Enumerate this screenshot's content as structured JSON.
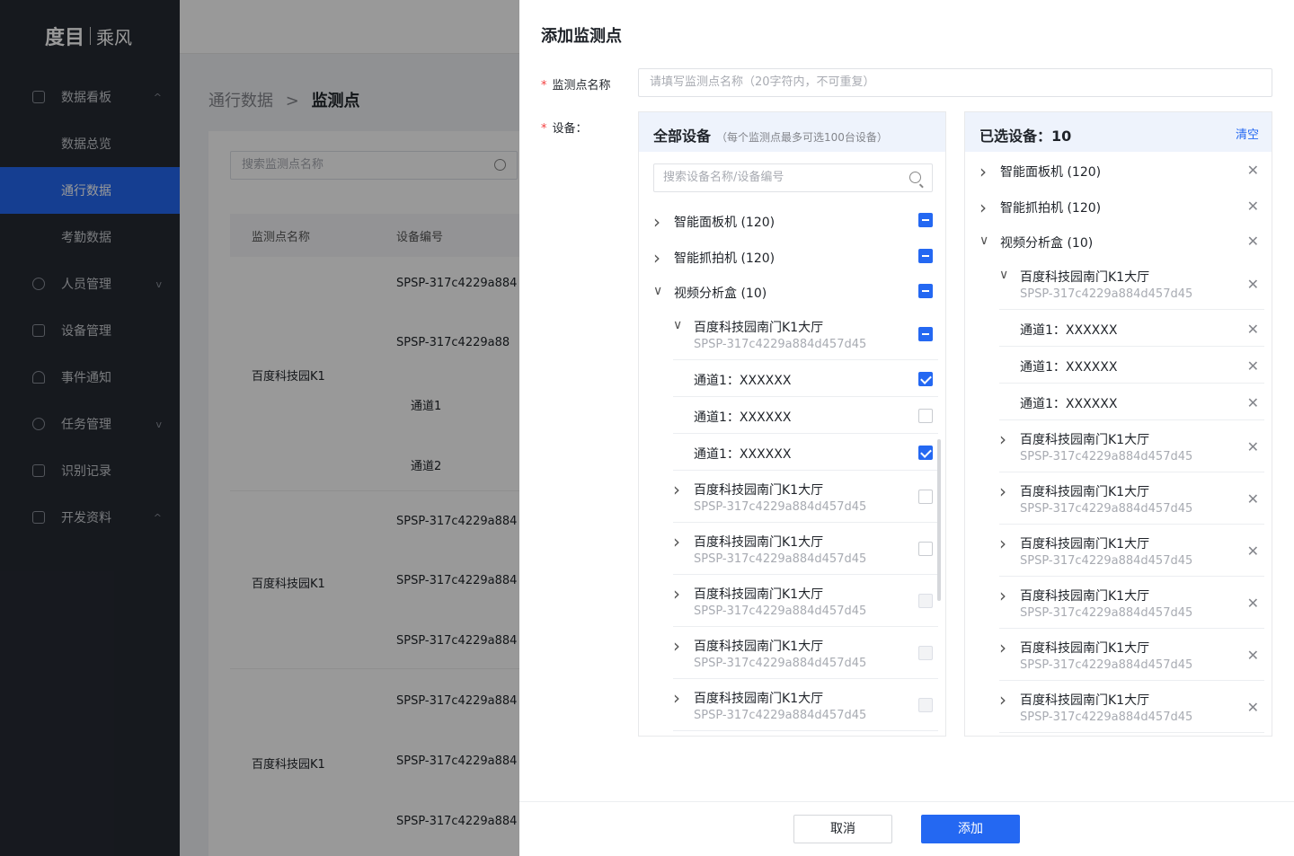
{
  "sidebar": {
    "logo_main": "度目",
    "logo_sub": "乘风",
    "items": [
      {
        "label": "数据看板",
        "chev": "^"
      },
      {
        "label": "数据总览",
        "chev": ""
      },
      {
        "label": "通行数据",
        "chev": ""
      },
      {
        "label": "考勤数据",
        "chev": ""
      },
      {
        "label": "人员管理",
        "chev": "v"
      },
      {
        "label": "设备管理",
        "chev": ""
      },
      {
        "label": "事件通知",
        "chev": ""
      },
      {
        "label": "任务管理",
        "chev": "v"
      },
      {
        "label": "识别记录",
        "chev": ""
      },
      {
        "label": "开发资料",
        "chev": "^"
      }
    ]
  },
  "background": {
    "breadcrumb_parent": "通行数据",
    "breadcrumb_sep": ">",
    "breadcrumb_current": "监测点",
    "search_placeholder": "搜索监测点名称",
    "col_name": "监测点名称",
    "col_device": "设备编号",
    "cells": {
      "c1": "SPSP-317c4229a884",
      "c2": "SPSP-317c4229a88",
      "ch1": "通道1",
      "ch2": "通道2",
      "k1a": "百度科技园K1",
      "c3": "SPSP-317c4229a884",
      "c4": "SPSP-317c4229a884",
      "k1b": "百度科技园K1",
      "c5": "SPSP-317c4229a884",
      "c6": "SPSP-317c4229a884",
      "k1c": "百度科技园K1",
      "c7": "SPSP-317c4229a884",
      "c8": "SPSP-317c4229a884"
    }
  },
  "drawer": {
    "title": "添加监测点",
    "name_label": "监测点名称",
    "name_placeholder": "请填写监测点名称（20字符内，不可重复）",
    "device_label": "设备：",
    "required_mark": "*",
    "left_panel": {
      "title": "全部设备",
      "hint": "（每个监测点最多可选100台设备）",
      "search_placeholder": "搜索设备名称/设备编号",
      "rows": [
        {
          "name": "智能面板机 (120)",
          "state": "partial"
        },
        {
          "name": "智能抓拍机 (120)",
          "state": "partial"
        },
        {
          "name": "视频分析盒 (10)",
          "state": "partial"
        },
        {
          "name": "百度科技园南门K1大厅",
          "code": "SPSP-317c4229a884d457d45",
          "state": "partial"
        },
        {
          "name": "通道1：XXXXXX",
          "state": "checked"
        },
        {
          "name": "通道1：XXXXXX",
          "state": "unchecked"
        },
        {
          "name": "通道1：XXXXXX",
          "state": "checked"
        },
        {
          "name": "百度科技园南门K1大厅",
          "code": "SPSP-317c4229a884d457d45",
          "state": "unchecked"
        },
        {
          "name": "百度科技园南门K1大厅",
          "code": "SPSP-317c4229a884d457d45",
          "state": "unchecked"
        },
        {
          "name": "百度科技园南门K1大厅",
          "code": "SPSP-317c4229a884d457d45",
          "state": "disabled"
        },
        {
          "name": "百度科技园南门K1大厅",
          "code": "SPSP-317c4229a884d457d45",
          "state": "disabled"
        },
        {
          "name": "百度科技园南门K1大厅",
          "code": "SPSP-317c4229a884d457d45",
          "state": "disabled"
        }
      ]
    },
    "right_panel": {
      "title": "已选设备：10",
      "clear_label": "清空",
      "rows": [
        {
          "name": "智能面板机 (120)"
        },
        {
          "name": "智能抓拍机 (120)"
        },
        {
          "name": "视频分析盒 (10)"
        },
        {
          "name": "百度科技园南门K1大厅",
          "code": "SPSP-317c4229a884d457d45"
        },
        {
          "name": "通道1：XXXXXX"
        },
        {
          "name": "通道1：XXXXXX"
        },
        {
          "name": "通道1：XXXXXX"
        },
        {
          "name": "百度科技园南门K1大厅",
          "code": "SPSP-317c4229a884d457d45"
        },
        {
          "name": "百度科技园南门K1大厅",
          "code": "SPSP-317c4229a884d457d45"
        },
        {
          "name": "百度科技园南门K1大厅",
          "code": "SPSP-317c4229a884d457d45"
        },
        {
          "name": "百度科技园南门K1大厅",
          "code": "SPSP-317c4229a884d457d45"
        },
        {
          "name": "百度科技园南门K1大厅",
          "code": "SPSP-317c4229a884d457d45"
        },
        {
          "name": "百度科技园南门K1大厅",
          "code": "SPSP-317c4229a884d457d45"
        }
      ]
    },
    "cancel_label": "取消",
    "add_label": "添加"
  }
}
